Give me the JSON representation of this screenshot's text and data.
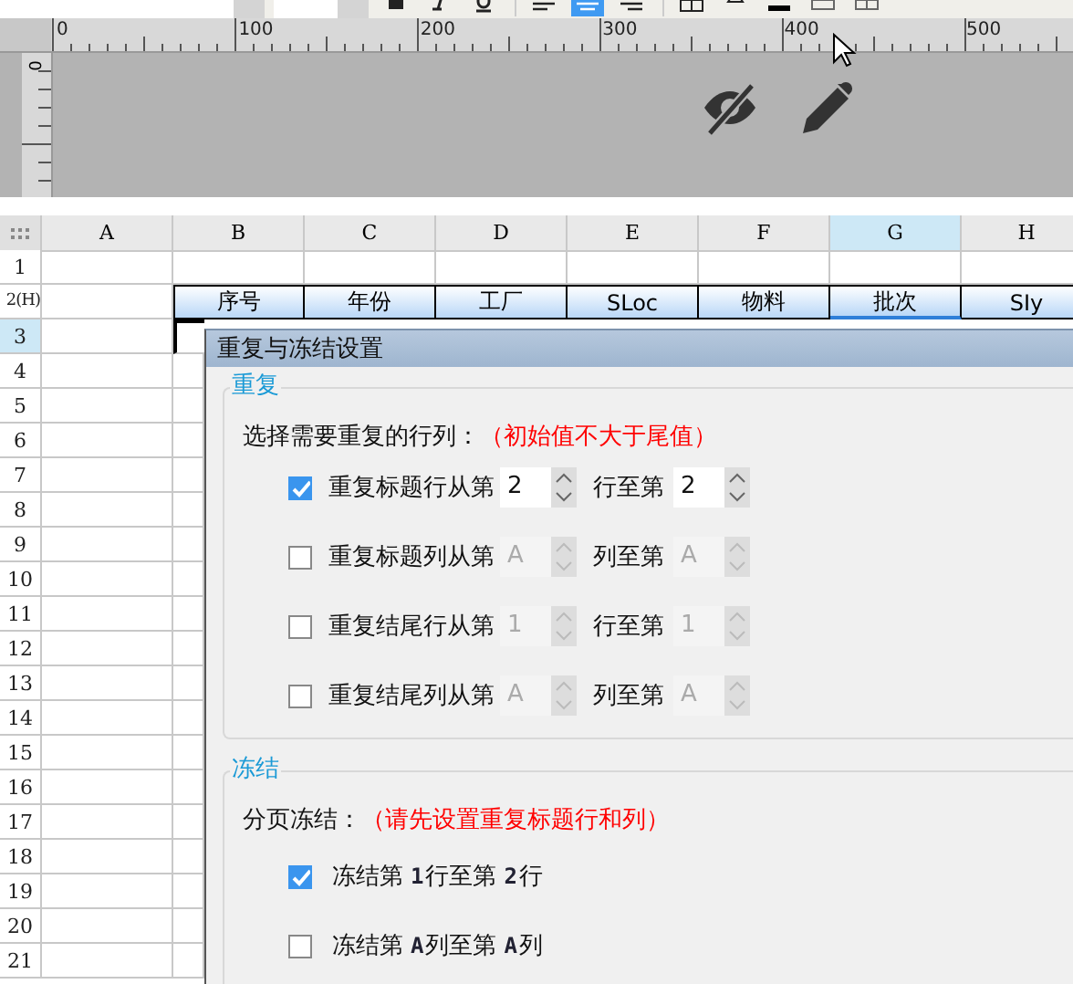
{
  "toolbar": {
    "align": [
      {
        "selected": false
      },
      {
        "selected": true
      },
      {
        "selected": false
      }
    ]
  },
  "ruler": {
    "labels": [
      "0",
      "100",
      "200",
      "300",
      "400",
      "500"
    ],
    "side_label": "0"
  },
  "sheet": {
    "columns": [
      {
        "label": "A",
        "selected": false
      },
      {
        "label": "B",
        "selected": false
      },
      {
        "label": "C",
        "selected": false
      },
      {
        "label": "D",
        "selected": false
      },
      {
        "label": "E",
        "selected": false
      },
      {
        "label": "F",
        "selected": false
      },
      {
        "label": "G",
        "selected": true
      },
      {
        "label": "H",
        "selected": false
      }
    ],
    "rows": [
      {
        "label": "1",
        "selected": false
      },
      {
        "label": "2(H)",
        "selected": false
      },
      {
        "label": "3",
        "selected": true
      },
      {
        "label": "4",
        "selected": false
      },
      {
        "label": "5",
        "selected": false
      },
      {
        "label": "6",
        "selected": false
      },
      {
        "label": "7",
        "selected": false
      },
      {
        "label": "8",
        "selected": false
      },
      {
        "label": "9",
        "selected": false
      },
      {
        "label": "10",
        "selected": false
      },
      {
        "label": "11",
        "selected": false
      },
      {
        "label": "12",
        "selected": false
      },
      {
        "label": "13",
        "selected": false
      },
      {
        "label": "14",
        "selected": false
      },
      {
        "label": "15",
        "selected": false
      },
      {
        "label": "16",
        "selected": false
      },
      {
        "label": "17",
        "selected": false
      },
      {
        "label": "18",
        "selected": false
      },
      {
        "label": "19",
        "selected": false
      },
      {
        "label": "20",
        "selected": false
      },
      {
        "label": "21",
        "selected": false
      }
    ],
    "header_row": [
      "序号",
      "年份",
      "工厂",
      "SLoc",
      "物料",
      "批次",
      "SIy"
    ]
  },
  "dialog": {
    "title": "重复与冻结设置",
    "repeat": {
      "legend": "重复",
      "prompt": "选择需要重复的行列：",
      "hint": "（初始值不大于尾值）",
      "rows": [
        {
          "checked": true,
          "label": "重复标题行从第",
          "from": "2",
          "to_label": "行至第",
          "to": "2"
        },
        {
          "checked": false,
          "label": "重复标题列从第",
          "from": "A",
          "to_label": "列至第",
          "to": "A"
        },
        {
          "checked": false,
          "label": "重复结尾行从第",
          "from": "1",
          "to_label": "行至第",
          "to": "1"
        },
        {
          "checked": false,
          "label": "重复结尾列从第",
          "from": "A",
          "to_label": "列至第",
          "to": "A"
        }
      ]
    },
    "freeze": {
      "legend": "冻结",
      "prompt": "分页冻结：",
      "hint": "（请先设置重复标题行和列）",
      "rows": [
        {
          "checked": true,
          "parts": [
            "冻结第",
            "1",
            "行至第",
            "2",
            "行"
          ]
        },
        {
          "checked": false,
          "parts": [
            "冻结第",
            "A",
            "列至第",
            "A",
            "列"
          ]
        }
      ]
    }
  }
}
